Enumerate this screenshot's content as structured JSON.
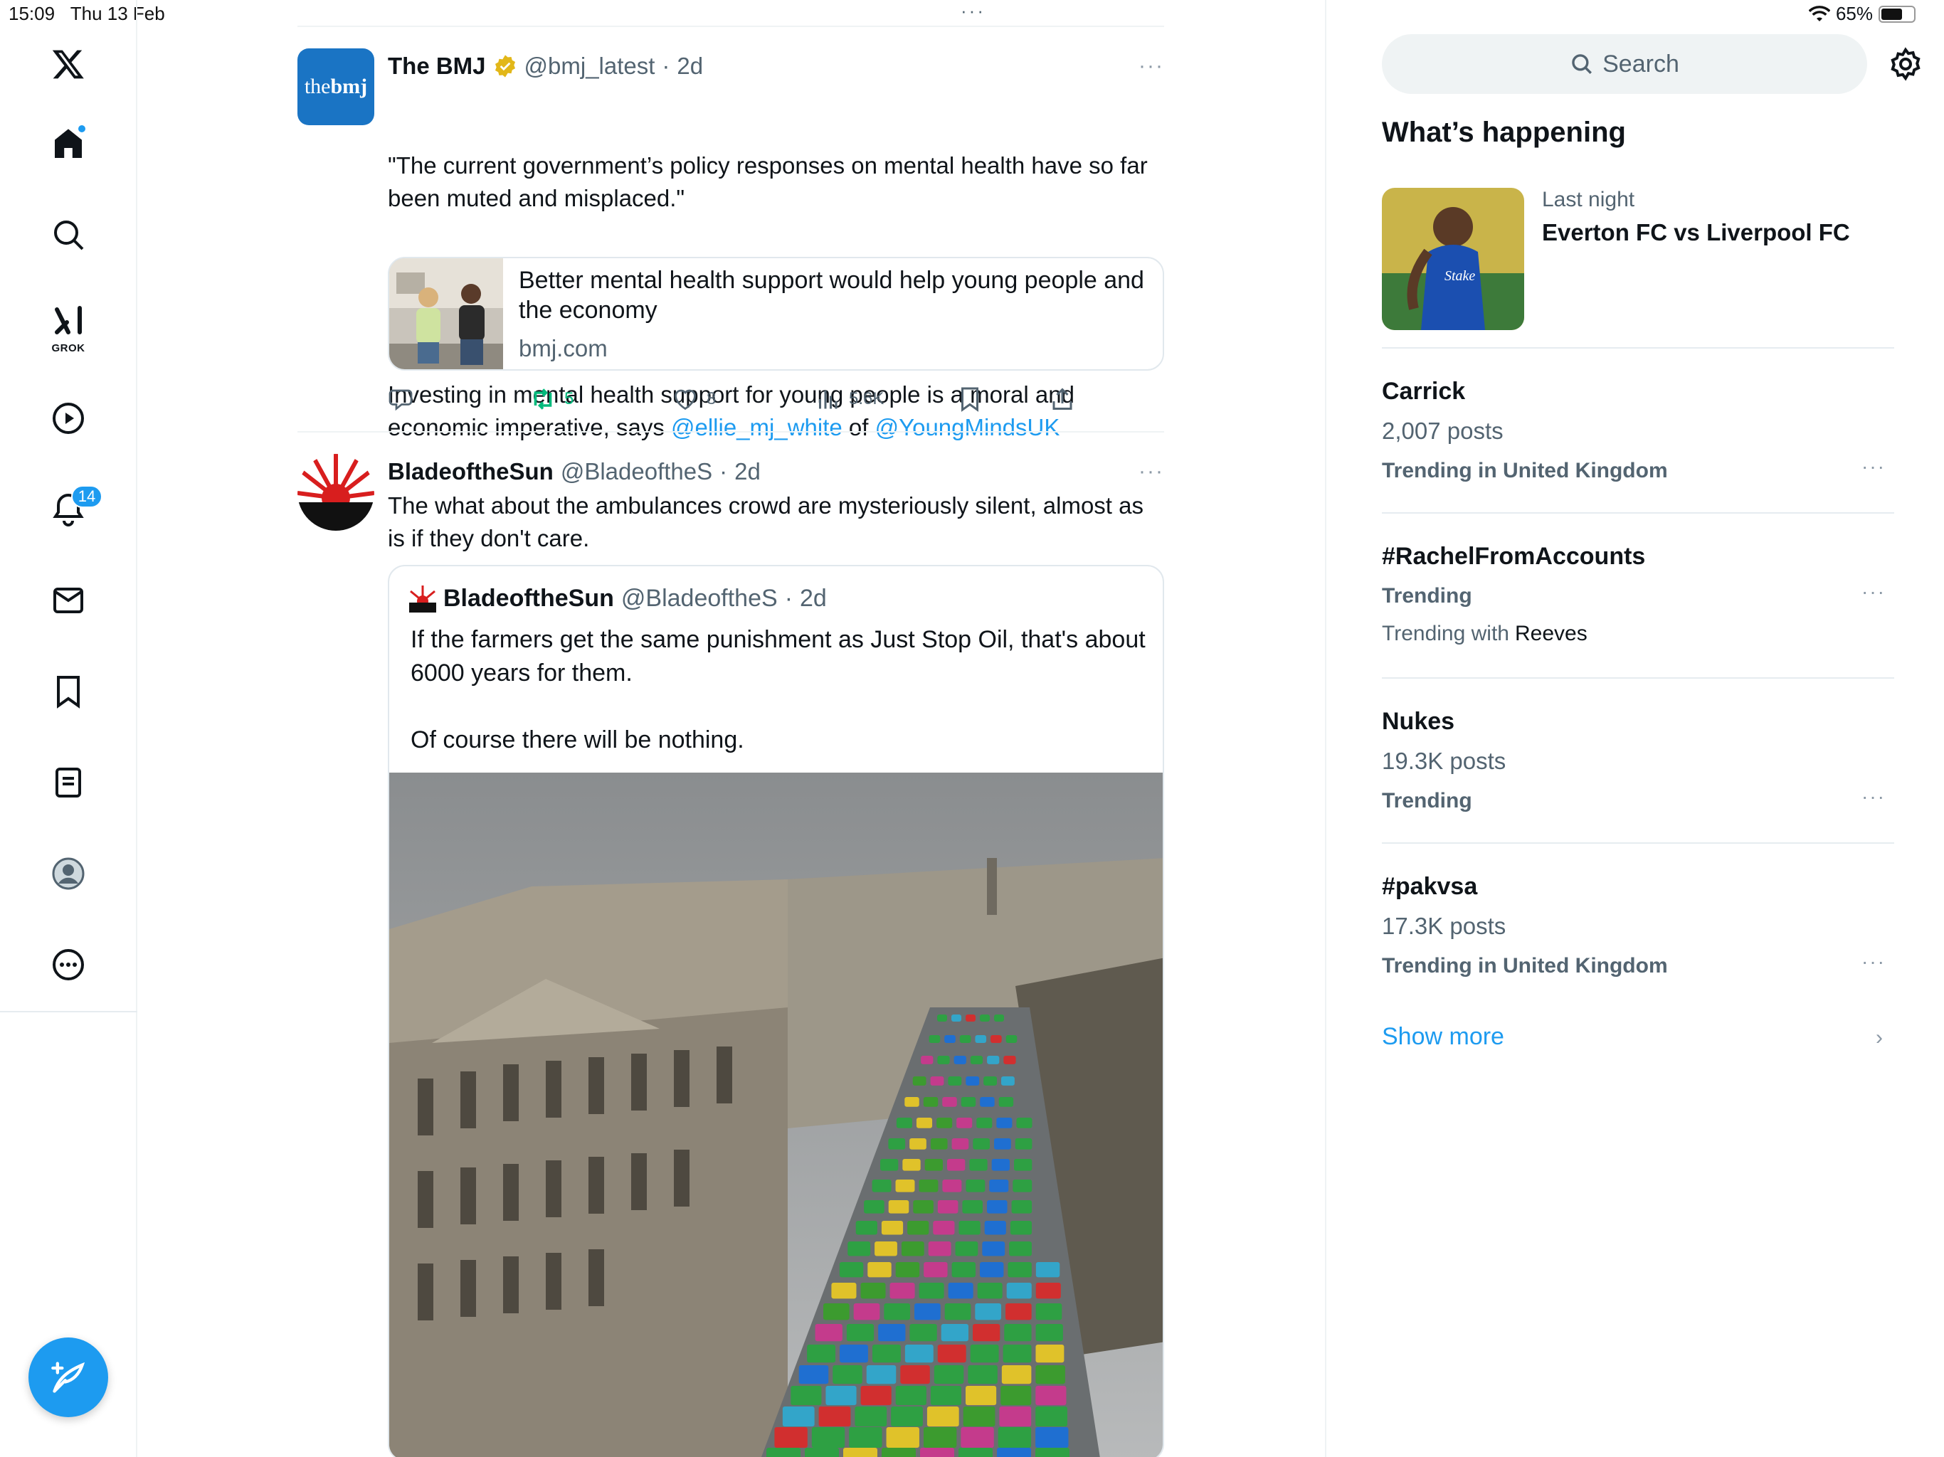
{
  "status_bar": {
    "time": "15:09",
    "date": "Thu 13 Feb",
    "battery": "65%",
    "battery_level": 0.65
  },
  "nav": {
    "items": [
      {
        "name": "x-logo-icon"
      },
      {
        "name": "home-icon",
        "has_dot": true
      },
      {
        "name": "search-icon"
      },
      {
        "name": "grok-icon",
        "label": "GROK"
      },
      {
        "name": "video-icon"
      },
      {
        "name": "notifications-icon",
        "badge": "14"
      },
      {
        "name": "messages-icon"
      },
      {
        "name": "bookmarks-icon"
      },
      {
        "name": "lists-icon"
      },
      {
        "name": "profile-icon"
      },
      {
        "name": "more-icon"
      }
    ],
    "compose_icon": "compose-icon"
  },
  "timeline": {
    "tweets": [
      {
        "name": "The BMJ",
        "handle": "@bmj_latest",
        "time": "2d",
        "verified": true,
        "avatar_text_light": "the",
        "avatar_text_bold": "bmj",
        "text_1": "\"The current government’s policy responses on mental health have so far been muted and misplaced.\"",
        "text_2_pre": "Investing in mental health support for young people is a moral and economic imperative, says ",
        "mention_1": "@ellie_mj_white",
        "text_2_mid": " of ",
        "mention_2": "@YoungMindsUK",
        "card": {
          "title": "Better mental health support would help young people and the economy",
          "domain": "bmj.com"
        },
        "stats": {
          "reposts": "5",
          "likes": "8",
          "views": "5.6K"
        }
      },
      {
        "name": "BladeoftheSun",
        "handle": "@BladeoftheS",
        "time": "2d",
        "text": "The what about the ambulances crowd are mysteriously silent, almost as is if they don't care.",
        "quote": {
          "name": "BladeoftheSun",
          "handle": "@BladeoftheS",
          "time": "2d",
          "text": "If the farmers get the same punishment as Just Stop Oil, that's about 6000 years for them.\n\nOf course there will be nothing."
        }
      }
    ],
    "separator": "·"
  },
  "right": {
    "search_placeholder": "Search",
    "heading": "What’s happening",
    "event": {
      "subtitle": "Last night",
      "title": "Everton FC vs Liverpool FC"
    },
    "trends": [
      {
        "title": "Carrick",
        "posts": "2,007 posts",
        "meta": "Trending in United Kingdom"
      },
      {
        "title": "#RachelFromAccounts",
        "meta": "Trending",
        "with_label": "Trending with",
        "with_value": "Reeves"
      },
      {
        "title": "Nukes",
        "posts": "19.3K posts",
        "meta": "Trending"
      },
      {
        "title": "#pakvsa",
        "posts": "17.3K posts",
        "meta": "Trending in United Kingdom"
      }
    ],
    "more_dots": "···",
    "show_more": "Show more",
    "chevron": "›"
  },
  "colors": {
    "accent": "#1d9bf0",
    "repost": "#00ba7c",
    "bmj_blue": "#1a74c4"
  }
}
